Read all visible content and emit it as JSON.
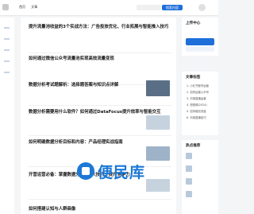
{
  "header": {
    "nav": [
      "首页",
      "文章"
    ],
    "search_button": "搜索内容"
  },
  "articles": [
    {
      "title": "提升流量池收益的3个实战方法：广告投放优化、行业拓展与智能推入技巧",
      "summary": "",
      "meta": ""
    },
    {
      "title": "如何通过微信公众号流量池实现高效流量变现",
      "summary": "",
      "meta": ""
    },
    {
      "title": "数据分析考试题解析：选择题答案与知识点详解",
      "summary": "",
      "meta": ""
    },
    {
      "title": "数据分析需要用什么软件？如何通过DataFocus提升效率与智能交互",
      "summary": "",
      "meta": ""
    },
    {
      "title": "如何明确数据分析目标和内容：产品经理实战指南",
      "summary": "",
      "meta": ""
    },
    {
      "title": "开营运营必备：掌握数据分析的5大技巧，提升竞争力",
      "summary": "",
      "meta": ""
    },
    {
      "title": "如何搭建认知与人群画像",
      "summary": "",
      "meta": ""
    }
  ],
  "rail": {
    "center_title": "上传中心",
    "tags_title": "文章标签",
    "tags": [
      "1. 小红书账号运营",
      "2. 如何运营公众号",
      "3. 抖音直播运营",
      "4. 短视频(2024)",
      "5. 如何增加流量",
      "6. 抖音直播技巧"
    ],
    "recommend_title": "热点推荐",
    "recommend": [
      "",
      "",
      "",
      ""
    ]
  },
  "watermark": "便民库",
  "colors": {
    "accent": "#1e6fd9",
    "watermark": "#1b78d6"
  }
}
